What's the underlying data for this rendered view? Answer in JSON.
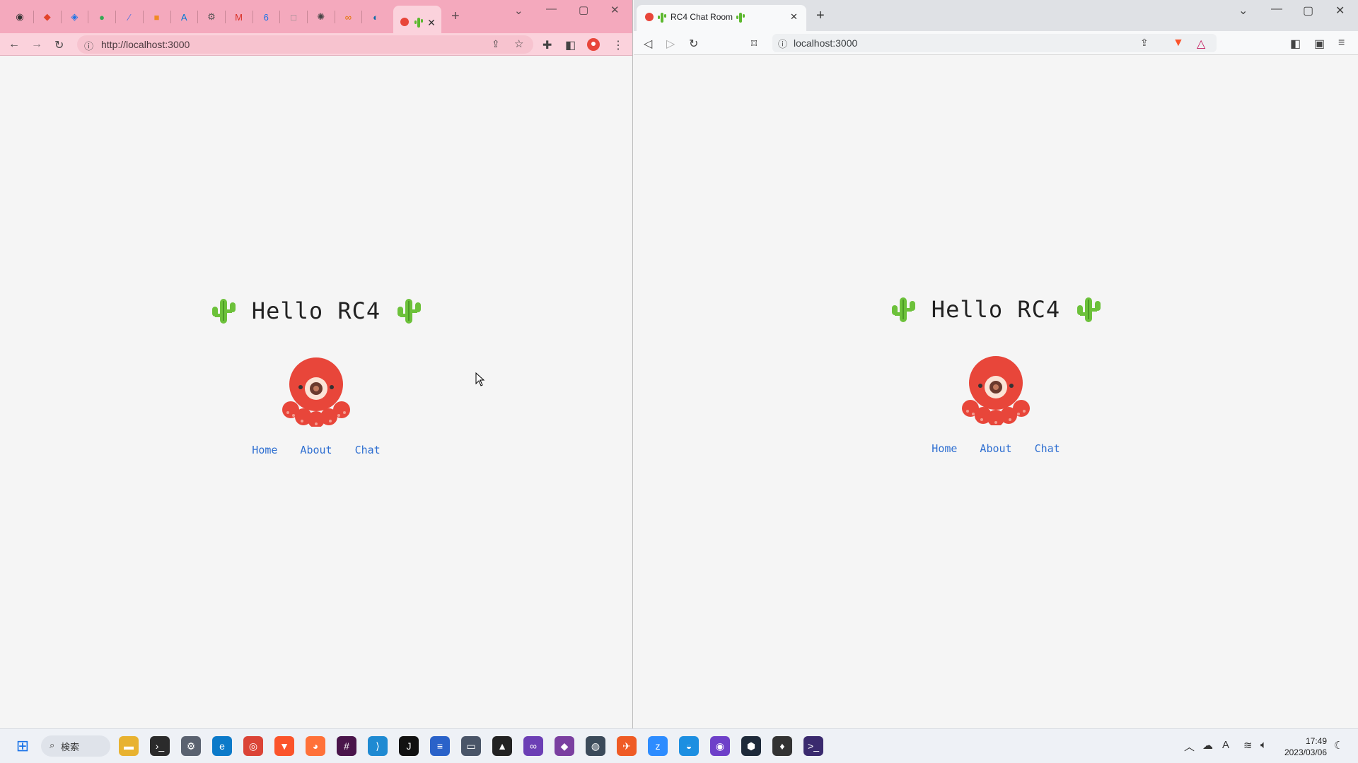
{
  "left_window": {
    "url": "http://localhost:3000",
    "tab_icons": [
      {
        "icon": "github-icon",
        "glyph": "◉",
        "color": "#333333"
      },
      {
        "icon": "gitlab-icon",
        "glyph": "◆",
        "color": "#e24329"
      },
      {
        "icon": "app-icon-blue",
        "glyph": "◈",
        "color": "#1a73e8"
      },
      {
        "icon": "app-icon-green",
        "glyph": "●",
        "color": "#34a853"
      },
      {
        "icon": "app-icon-slash",
        "glyph": "∕",
        "color": "#4a6ee0"
      },
      {
        "icon": "box-icon",
        "glyph": "■",
        "color": "#f08a24"
      },
      {
        "icon": "azure-icon",
        "glyph": "A",
        "color": "#0078d4"
      },
      {
        "icon": "settings-icon",
        "glyph": "⚙",
        "color": "#555555"
      },
      {
        "icon": "gmail-icon",
        "glyph": "M",
        "color": "#d93025"
      },
      {
        "icon": "calendar-icon",
        "glyph": "6",
        "color": "#1a73e8"
      },
      {
        "icon": "window-icon",
        "glyph": "□",
        "color": "#888888"
      },
      {
        "icon": "openai-icon",
        "glyph": "✺",
        "color": "#444444"
      },
      {
        "icon": "link-icon",
        "glyph": "∞",
        "color": "#e37400"
      },
      {
        "icon": "edge-icon",
        "glyph": "◐",
        "color": "#0b6aa8"
      }
    ]
  },
  "right_window": {
    "tab_title": "RC4 Chat Room",
    "url": "localhost:3000"
  },
  "page": {
    "heading": "Hello RC4",
    "nav": [
      "Home",
      "About",
      "Chat"
    ]
  },
  "taskbar": {
    "search_label": "検索",
    "time": "17:49",
    "date": "2023/03/06",
    "apps": [
      {
        "icon": "file-explorer-icon",
        "glyph": "▬",
        "color": "#e8b230"
      },
      {
        "icon": "terminal-icon",
        "glyph": "›_",
        "color": "#2b2b2b"
      },
      {
        "icon": "settings-icon",
        "glyph": "⚙",
        "color": "#5a6270"
      },
      {
        "icon": "edge-icon",
        "glyph": "e",
        "color": "#0c7ac9"
      },
      {
        "icon": "chrome-icon",
        "glyph": "◎",
        "color": "#db4437"
      },
      {
        "icon": "brave-icon",
        "glyph": "▼",
        "color": "#fb542b"
      },
      {
        "icon": "firefox-icon",
        "glyph": "◕",
        "color": "#ff7139"
      },
      {
        "icon": "slack-icon",
        "glyph": "#",
        "color": "#4a154b"
      },
      {
        "icon": "vscode-icon",
        "glyph": "⟩",
        "color": "#1f8ad2"
      },
      {
        "icon": "jetbrains-icon",
        "glyph": "J",
        "color": "#111111"
      },
      {
        "icon": "notepad-icon",
        "glyph": "≡",
        "color": "#2a62c9"
      },
      {
        "icon": "remote-desktop-icon",
        "glyph": "▭",
        "color": "#4a5568"
      },
      {
        "icon": "inkscape-icon",
        "glyph": "▲",
        "color": "#222222"
      },
      {
        "icon": "visual-studio-icon",
        "glyph": "∞",
        "color": "#6c3fb5"
      },
      {
        "icon": "app-purple-icon",
        "glyph": "◆",
        "color": "#7a3fa0"
      },
      {
        "icon": "blender-icon",
        "glyph": "◍",
        "color": "#3b4a5a"
      },
      {
        "icon": "postman-icon",
        "glyph": "✈",
        "color": "#ef5b25"
      },
      {
        "icon": "zoom-icon",
        "glyph": "z",
        "color": "#2d8cff"
      },
      {
        "icon": "docker-icon",
        "glyph": "◒",
        "color": "#1d8fe1"
      },
      {
        "icon": "github-desktop-icon",
        "glyph": "◉",
        "color": "#6e40c9"
      },
      {
        "icon": "app-dark-icon",
        "glyph": "⬢",
        "color": "#1e2a3a"
      },
      {
        "icon": "mongodb-icon",
        "glyph": "♦",
        "color": "#333333"
      },
      {
        "icon": "terminal-purple-icon",
        "glyph": ">_",
        "color": "#3a2a6e"
      }
    ]
  }
}
